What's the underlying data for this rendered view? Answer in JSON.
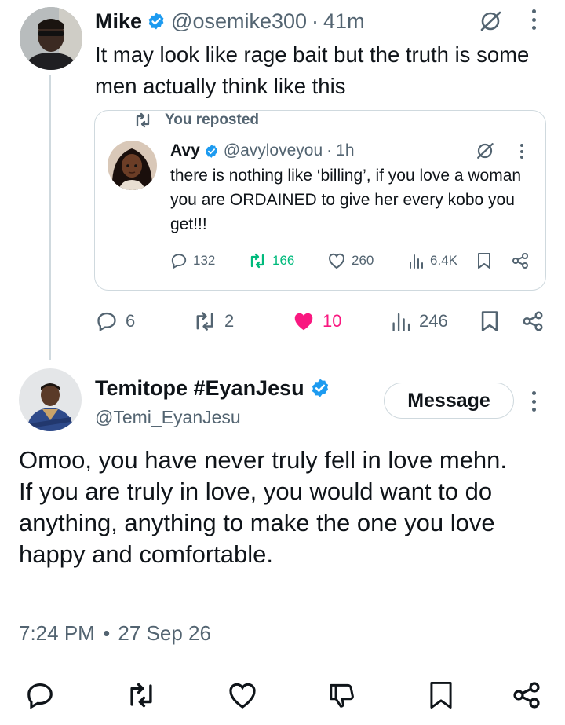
{
  "tweet": {
    "author_name": "Mike",
    "author_handle": "@osemike300",
    "separator": "·",
    "time": "41m",
    "text": "It may look like rage bait but the truth is some men actually think like this",
    "quote": {
      "repost_label": "You reposted",
      "author_name": "Avy",
      "author_handle": "@avyloveyou",
      "separator": "·",
      "time": "1h",
      "text": "there is nothing like ‘billing’, if you love a woman you are ORDAINED to give her every kobo you get!!!",
      "replies": "132",
      "reposts": "166",
      "likes": "260",
      "views": "6.4K"
    },
    "replies": "6",
    "reposts": "2",
    "likes": "10",
    "views": "246"
  },
  "reply": {
    "author_name": "Temitope #EyanJesu",
    "author_handle": "@Temi_EyanJesu",
    "message_button": "Message",
    "paragraphs": [
      "Omoo, you have never truly fell in love mehn.",
      "If you are truly in love, you would want to do anything, anything to make the one you love happy and comfortable."
    ],
    "timestamp": "7:24 PM",
    "separator": "•",
    "date": "27 Sep 26"
  },
  "icons": {
    "verified": "verified-badge-icon",
    "grok": "grok-icon",
    "more": "more-vertical-icon",
    "reply": "reply-icon",
    "repost": "repost-icon",
    "like": "heart-icon",
    "views": "views-icon",
    "bookmark": "bookmark-icon",
    "share": "share-icon",
    "dislike": "dislike-icon"
  },
  "colors": {
    "verified": "#1d9bf0",
    "repost_active": "#00ba7c",
    "like_active": "#f91880",
    "secondary_text": "#536471",
    "border": "#cfd9de"
  }
}
